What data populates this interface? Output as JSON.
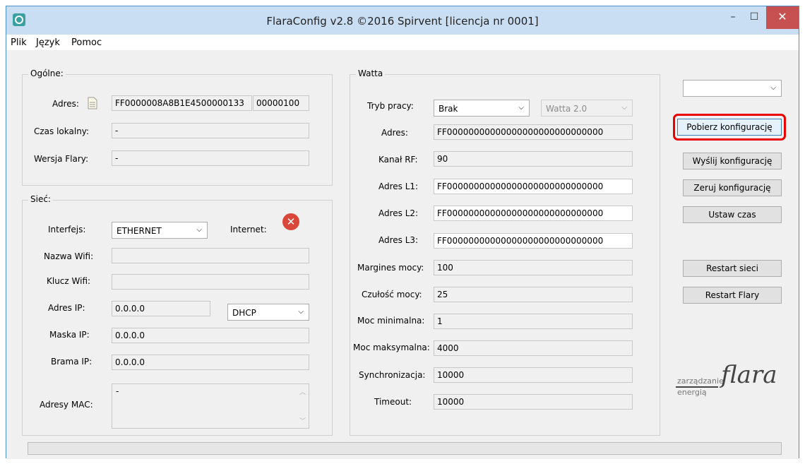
{
  "window": {
    "title": "FlaraConfig v2.8 ©2016 Spirvent [licencja nr 0001]"
  },
  "menu": [
    "Plik",
    "Język",
    "Pomoc"
  ],
  "ogolne": {
    "title": "Ogólne:",
    "adres_label": "Adres:",
    "adres_value": "FF0000008A8B1E4500000133",
    "adres_extra": "00000100",
    "czas_label": "Czas lokalny:",
    "czas_value": "-",
    "wersja_label": "Wersja Flary:",
    "wersja_value": "-"
  },
  "siec": {
    "title": "Sieć:",
    "interfejs_label": "Interfejs:",
    "interfejs_value": "ETHERNET",
    "internet_label": "Internet:",
    "nazwa_wifi_label": "Nazwa Wifi:",
    "nazwa_wifi_value": "",
    "klucz_wifi_label": "Klucz Wifi:",
    "klucz_wifi_value": "",
    "adres_ip_label": "Adres IP:",
    "adres_ip_value": "0.0.0.0",
    "ip_mode": "DHCP",
    "maska_label": "Maska IP:",
    "maska_value": "0.0.0.0",
    "brama_label": "Brama IP:",
    "brama_value": "0.0.0.0",
    "mac_label": "Adresy MAC:",
    "mac_value": "-"
  },
  "watta": {
    "title": "Watta",
    "tryb_label": "Tryb pracy:",
    "tryb_value": "Brak",
    "model_value": "Watta 2.0",
    "adres_label": "Adres:",
    "adres_value": "FF00000000000000000000000000000",
    "kanal_label": "Kanał RF:",
    "kanal_value": "90",
    "l1_label": "Adres L1:",
    "l1_value": "FF00000000000000000000000000000",
    "l2_label": "Adres L2:",
    "l2_value": "FF00000000000000000000000000000",
    "l3_label": "Adres L3:",
    "l3_value": "FF00000000000000000000000000000",
    "margines_label": "Margines mocy:",
    "margines_value": "100",
    "czulosc_label": "Czułość mocy:",
    "czulosc_value": "25",
    "min_label": "Moc minimalna:",
    "min_value": "1",
    "max_label": "Moc maksymalna:",
    "max_value": "4000",
    "sync_label": "Synchronizacja:",
    "sync_value": "10000",
    "timeout_label": "Timeout:",
    "timeout_value": "10000"
  },
  "actions": {
    "device_select": "",
    "pobierz": "Pobierz konfigurację",
    "wyslij": "Wyślij konfigurację",
    "zeruj": "Zeruj konfigurację",
    "ustaw_czas": "Ustaw czas",
    "restart_sieci": "Restart sieci",
    "restart_flary": "Restart Flary"
  },
  "logo": {
    "line1": "zarządzanie",
    "line2": "energią",
    "brand": "flara"
  }
}
